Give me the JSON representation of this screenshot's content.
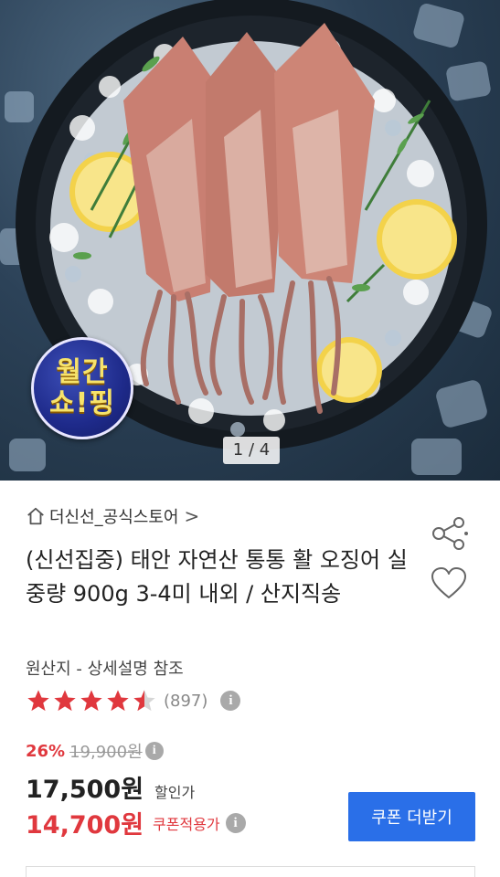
{
  "hero": {
    "badge_line1": "월간",
    "badge_line2": "쇼!핑",
    "page_indicator": "1 / 4"
  },
  "store": {
    "name": "더신선_공식스토어",
    "chevron": ">"
  },
  "product": {
    "title": "(신선집중) 태안 자연산 통통 활 오징어 실중량 900g 3-4미 내외 / 산지직송",
    "origin": "원산지 - 상세설명 참조",
    "rating": 4.5,
    "review_count": "(897)"
  },
  "price": {
    "discount_rate": "26%",
    "original_price": "19,900원",
    "sale_price": "17,500원",
    "sale_label": "할인가",
    "coupon_price": "14,700원",
    "coupon_label": "쿠폰적용가"
  },
  "actions": {
    "coupon_button": "쿠폰 더받기"
  },
  "colors": {
    "accent_red": "#e0383e",
    "button_blue": "#2a6fe8",
    "star_red": "#e0383e"
  },
  "icons": [
    "home-icon",
    "share-icon",
    "heart-icon",
    "star-icon",
    "info-icon"
  ]
}
